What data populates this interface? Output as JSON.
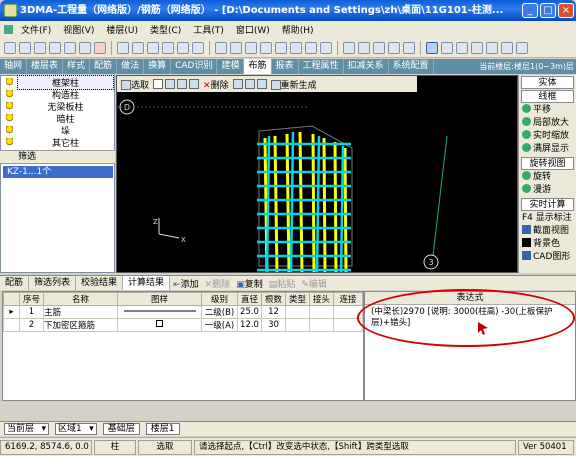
{
  "window": {
    "title": "3DMA-工程量（网络版）/钢筋（网络版） - [D:\\Documents and Settings\\zh\\桌面\\11G101-柱测..."
  },
  "menu": [
    "文件(F)",
    "视图(V)",
    "楼层(U)",
    "类型(C)",
    "工具(T)",
    "窗口(W)",
    "帮助(H)"
  ],
  "module_tabs": [
    "轴网",
    "楼层表",
    "样式",
    "配筋",
    "做法",
    "换算",
    "CAD识别",
    "建模",
    "布筋",
    "报表",
    "工程属性",
    "扣减关系",
    "系统配置"
  ],
  "active_module_tab": "布筋",
  "current_floor_label": "当前楼层:楼层1(0~3m)层",
  "tree": {
    "items": [
      "框架柱",
      "构造柱",
      "无梁板柱",
      "暗柱",
      "垛",
      "其它柱"
    ],
    "selected": "框架柱"
  },
  "filter": {
    "label": "筛选",
    "item": "KZ-1...1个"
  },
  "viewport_toolbar": {
    "select": "选取",
    "delete": "删除",
    "regen": "重新生成"
  },
  "viewport_labels": {
    "top_marker": "D",
    "bottom_marker": "3"
  },
  "right_panel": [
    "实体",
    "线框",
    "平移",
    "局部放大",
    "实时缩放",
    "满屏显示",
    "旋转视图",
    "旋转",
    "漫游",
    "实时计算",
    "F4 显示标注",
    "截面视图",
    "背景色",
    "CAD图形"
  ],
  "bottom_tabs": [
    "配筋",
    "筛选列表",
    "校验结果",
    "计算结果"
  ],
  "active_bottom_tab": "计算结果",
  "bottom_buttons": {
    "add": "添加",
    "delete": "删除",
    "copy": "复制",
    "paste": "粘贴",
    "edit": "编辑"
  },
  "table": {
    "headers": [
      "序号",
      "名称",
      "图样",
      "级别",
      "直径",
      "根数",
      "类型",
      "接头",
      "连接"
    ],
    "rows": [
      {
        "no": "1",
        "name": "主筋",
        "level": "二级(B)",
        "dia": "25.0",
        "count": "12"
      },
      {
        "no": "2",
        "name": "下加密区箍筋",
        "level": "一级(A)",
        "dia": "12.0",
        "count": "30"
      }
    ]
  },
  "expression": {
    "header": "表达式",
    "text": "(中梁长)2970 [说明: 3000(柱高) -30(上板保护层)+错头]"
  },
  "bottom_left": {
    "floor": "当前层",
    "area": "区域1",
    "sheet1": "基础层",
    "sheet2": "楼层1"
  },
  "status": {
    "coords": "6169.2, 8574.6, 0.0",
    "type": "柱",
    "mode": "选取",
    "hint": "请选择起点,【Ctrl】改变选中状态,【Shift】跨类型选取",
    "version": "Ver 50401"
  }
}
